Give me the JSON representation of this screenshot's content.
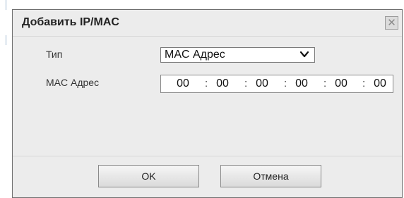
{
  "dialog": {
    "title": "Добавить IP/MAC",
    "close_icon": "close-icon"
  },
  "form": {
    "type_label": "Тип",
    "type_value": "MAC Адрес",
    "mac_label": "MAC Адрес",
    "mac_octets": [
      "00",
      "00",
      "00",
      "00",
      "00",
      "00"
    ],
    "mac_separator": ":"
  },
  "buttons": {
    "ok_label": "OK",
    "cancel_label": "Отмена"
  }
}
